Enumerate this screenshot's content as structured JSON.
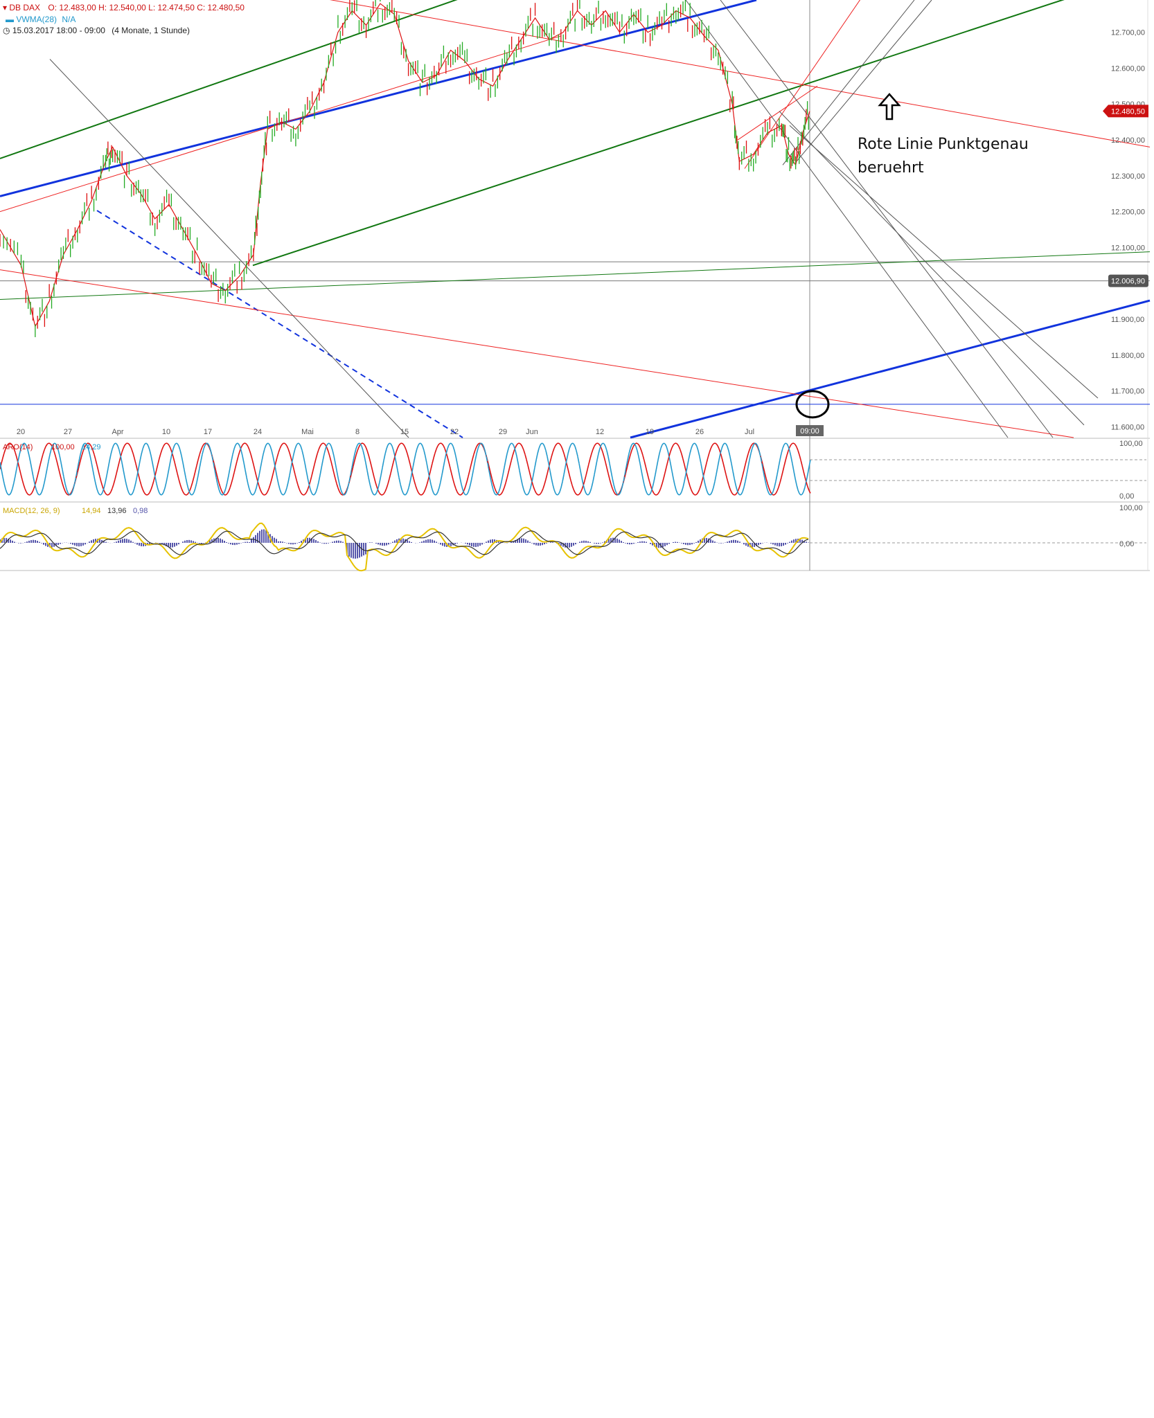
{
  "header": {
    "symbol": "DB DAX",
    "ohlc": "O: 12.483,00  H: 12.540,00  L: 12.474,50  C: 12.480,50",
    "vwma_label": "VWMA(28)",
    "vwma_value": "N/A",
    "range": "15.03.2017 18:00 - 09:00",
    "period": "(4 Monate, 1 Stunde)"
  },
  "annotation": {
    "line1": "Rote Linie Punktgenau",
    "line2": "beruehrt"
  },
  "colors": {
    "up": "#22aa22",
    "down": "#dd1111",
    "blue": "#1133dd",
    "green": "#117711",
    "red_line": "#ee2222",
    "gray_line": "#555555",
    "aroon_up": "#dd1111",
    "aroon_down": "#2299cc",
    "macd": "#e6c200",
    "signal": "#333333",
    "hist": "#5555aa"
  },
  "chart_data": [
    {
      "type": "line",
      "title": "DB DAX",
      "y_ticks": [
        "12.700,00",
        "12.600,00",
        "12.500,00",
        "12.400,00",
        "12.300,00",
        "12.200,00",
        "12.100,00",
        "12.006,90",
        "11.900,00",
        "11.800,00",
        "11.700,00",
        "11.600,00"
      ],
      "y_tick_values": [
        12700,
        12600,
        12500,
        12400,
        12300,
        12200,
        12100,
        12006.9,
        11900,
        11800,
        11700,
        11600
      ],
      "ylim": [
        11570,
        12790
      ],
      "x_ticks": [
        "20",
        "27",
        "Apr",
        "10",
        "17",
        "24",
        "Mai",
        "8",
        "15",
        "22",
        "29",
        "Jun",
        "12",
        "19",
        "26",
        "Jul",
        "09:00"
      ],
      "last_price_label": "12.480,50",
      "last_price": 12480.5,
      "hline_label": "12.006,90",
      "hline_value": 12006.9,
      "price_path": [
        [
          0,
          12150
        ],
        [
          3,
          12050
        ],
        [
          5,
          11880
        ],
        [
          7,
          11950
        ],
        [
          9,
          12080
        ],
        [
          11,
          12150
        ],
        [
          13,
          12230
        ],
        [
          15,
          12340
        ],
        [
          16,
          12380
        ],
        [
          18,
          12300
        ],
        [
          20,
          12250
        ],
        [
          22,
          12180
        ],
        [
          24,
          12220
        ],
        [
          26,
          12150
        ],
        [
          28,
          12080
        ],
        [
          30,
          12000
        ],
        [
          32,
          11980
        ],
        [
          34,
          12020
        ],
        [
          36,
          12080
        ],
        [
          37,
          12280
        ],
        [
          38,
          12430
        ],
        [
          40,
          12450
        ],
        [
          42,
          12430
        ],
        [
          44,
          12480
        ],
        [
          46,
          12560
        ],
        [
          48,
          12700
        ],
        [
          50,
          12760
        ],
        [
          52,
          12720
        ],
        [
          54,
          12780
        ],
        [
          56,
          12750
        ],
        [
          58,
          12620
        ],
        [
          60,
          12560
        ],
        [
          62,
          12580
        ],
        [
          64,
          12650
        ],
        [
          66,
          12620
        ],
        [
          68,
          12570
        ],
        [
          70,
          12550
        ],
        [
          72,
          12620
        ],
        [
          74,
          12680
        ],
        [
          76,
          12740
        ],
        [
          78,
          12680
        ],
        [
          80,
          12700
        ],
        [
          82,
          12760
        ],
        [
          84,
          12720
        ],
        [
          86,
          12760
        ],
        [
          88,
          12700
        ],
        [
          90,
          12750
        ],
        [
          92,
          12700
        ],
        [
          94,
          12720
        ],
        [
          96,
          12760
        ],
        [
          98,
          12740
        ],
        [
          100,
          12690
        ],
        [
          102,
          12650
        ],
        [
          104,
          12500
        ],
        [
          105,
          12340
        ],
        [
          107,
          12360
        ],
        [
          109,
          12420
        ],
        [
          111,
          12440
        ],
        [
          112,
          12360
        ],
        [
          113,
          12330
        ],
        [
          114,
          12420
        ],
        [
          115,
          12480
        ]
      ],
      "x_range": [
        0,
        115
      ]
    },
    {
      "type": "line",
      "title": "ARO(14)",
      "series": [
        {
          "name": "ARO(14) up",
          "last": "100,00"
        },
        {
          "name": "ARO(14) down",
          "last": "14,29"
        }
      ],
      "y_ticks": [
        "100,00",
        "0,00"
      ],
      "ylim": [
        0,
        100
      ]
    },
    {
      "type": "line",
      "title": "MACD(12, 26, 9)",
      "series": [
        {
          "name": "MACD",
          "last": "14,94"
        },
        {
          "name": "Signal",
          "last": "13,96"
        },
        {
          "name": "Histogram",
          "last": "0,98"
        }
      ],
      "y_ticks": [
        "100,00",
        "0,00"
      ],
      "ylim": [
        -60,
        100
      ]
    }
  ]
}
